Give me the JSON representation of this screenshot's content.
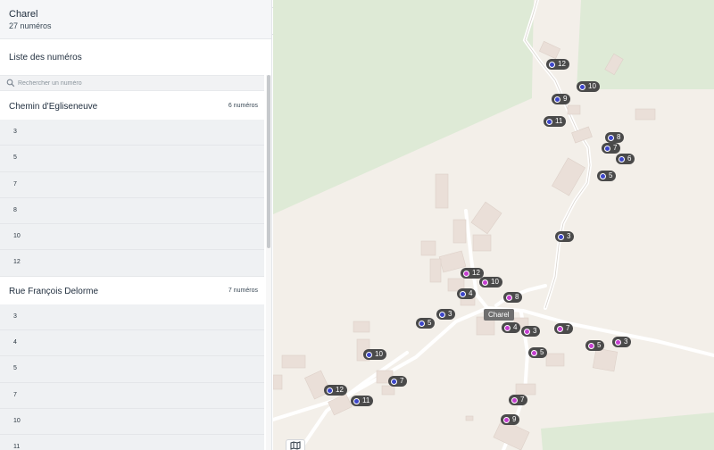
{
  "commune": {
    "name": "Charel",
    "count": "27 numéros"
  },
  "list": {
    "title": "Liste des numéros"
  },
  "search": {
    "placeholder": "Rechercher un numéro"
  },
  "voies": [
    {
      "name": "Chemin d'Egliseneuve",
      "count": "6 numéros",
      "numbers": [
        "3",
        "5",
        "7",
        "8",
        "10",
        "12"
      ]
    },
    {
      "name": "Rue François Delorme",
      "count": "7 numéros",
      "numbers": [
        "3",
        "4",
        "5",
        "7",
        "10",
        "11"
      ]
    }
  ],
  "map": {
    "locality": "Charel",
    "colors": {
      "blue_dot": "#3d46c9",
      "pink_dot": "#c53fd0",
      "pin_bg": "#4a4a4a",
      "forest": "#deead6",
      "land": "#f3efe9",
      "building": "#eadfd8"
    },
    "pins": [
      {
        "label": "12",
        "color": "blue"
      },
      {
        "label": "10",
        "color": "blue"
      },
      {
        "label": "9",
        "color": "blue"
      },
      {
        "label": "11",
        "color": "blue"
      },
      {
        "label": "8",
        "color": "blue"
      },
      {
        "label": "7",
        "color": "blue"
      },
      {
        "label": "6",
        "color": "blue"
      },
      {
        "label": "5",
        "color": "blue"
      },
      {
        "label": "3",
        "color": "blue"
      },
      {
        "label": "12",
        "color": "pink"
      },
      {
        "label": "10",
        "color": "pink"
      },
      {
        "label": "4",
        "color": "blue"
      },
      {
        "label": "8",
        "color": "pink"
      },
      {
        "label": "3",
        "color": "blue"
      },
      {
        "label": "5",
        "color": "blue"
      },
      {
        "label": "4",
        "color": "pink"
      },
      {
        "label": "3",
        "color": "pink"
      },
      {
        "label": "7",
        "color": "pink"
      },
      {
        "label": "5",
        "color": "pink"
      },
      {
        "label": "3",
        "color": "pink"
      },
      {
        "label": "5",
        "color": "pink"
      },
      {
        "label": "10",
        "color": "blue"
      },
      {
        "label": "7",
        "color": "blue"
      },
      {
        "label": "12",
        "color": "blue"
      },
      {
        "label": "11",
        "color": "blue"
      },
      {
        "label": "7",
        "color": "pink"
      },
      {
        "label": "9",
        "color": "pink"
      }
    ]
  },
  "icons": {
    "collapse": "chevron-left-icon",
    "search": "search-icon",
    "map_style": "map-icon"
  }
}
